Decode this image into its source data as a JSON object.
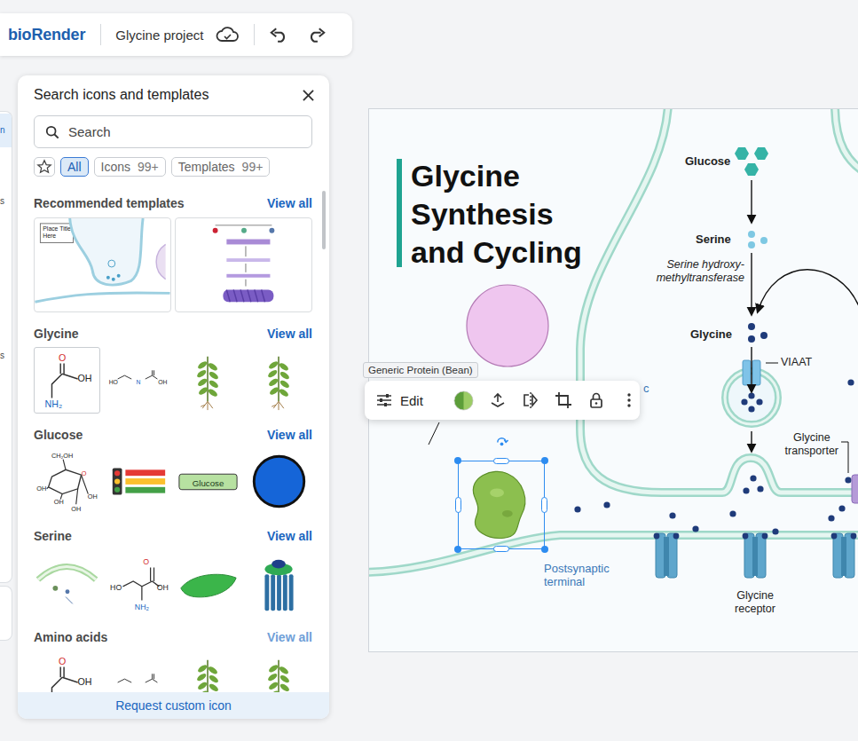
{
  "toolbar": {
    "logo": "bioRender",
    "project": "Glycine project"
  },
  "side_rail": {
    "fragments": [
      {
        "text": "n",
        "selected": true
      },
      {
        "text": "s",
        "selected": false
      },
      {
        "text": "s",
        "selected": false
      }
    ]
  },
  "panel": {
    "title": "Search icons and templates",
    "search": {
      "placeholder": "Search"
    },
    "filters": [
      {
        "label": "All",
        "count": "",
        "selected": true
      },
      {
        "label": "Icons",
        "count": "99+",
        "selected": false
      },
      {
        "label": "Templates",
        "count": "99+",
        "selected": false
      }
    ],
    "templates": {
      "title": "Recommended templates",
      "view_all": "View all",
      "items": [
        {
          "kind": "synapse",
          "labels": [
            "Place Title",
            "Here"
          ]
        },
        {
          "kind": "flowchart",
          "labels": []
        }
      ]
    },
    "sections": [
      {
        "title": "Glycine",
        "view_all": "View all",
        "muted": false,
        "icons": [
          {
            "kind": "structure-glycine",
            "labels": [
              "O",
              "OH",
              "NH₂"
            ],
            "hovered": true
          },
          {
            "kind": "chain",
            "labels": [
              "HO",
              "N",
              "OH"
            ],
            "hovered": false
          },
          {
            "kind": "plant",
            "labels": [],
            "hovered": false
          },
          {
            "kind": "plant",
            "labels": [],
            "hovered": false
          }
        ]
      },
      {
        "title": "Glucose",
        "view_all": "View all",
        "muted": false,
        "icons": [
          {
            "kind": "structure-glucose",
            "labels": [
              "CH₂OH",
              "O",
              "OH",
              "OH",
              "OH",
              "OH"
            ],
            "hovered": false
          },
          {
            "kind": "traffic",
            "labels": [],
            "hovered": false
          },
          {
            "kind": "button",
            "labels": [
              "Glucose"
            ],
            "hovered": false
          },
          {
            "kind": "circle",
            "labels": [],
            "hovered": false
          }
        ]
      },
      {
        "title": "Serine",
        "view_all": "View all",
        "muted": false,
        "icons": [
          {
            "kind": "membrane",
            "labels": [],
            "hovered": false
          },
          {
            "kind": "structure-serine",
            "labels": [
              "O",
              "HO",
              "OH",
              "NH₂"
            ],
            "hovered": false
          },
          {
            "kind": "bean",
            "labels": [],
            "hovered": false
          },
          {
            "kind": "receptor",
            "labels": [],
            "hovered": false
          }
        ]
      },
      {
        "title": "Amino acids",
        "view_all": "View all",
        "muted": true,
        "icons": [
          {
            "kind": "structure-glycine",
            "labels": [
              "O",
              "OH"
            ],
            "hovered": false
          },
          {
            "kind": "chain",
            "labels": [],
            "hovered": false
          },
          {
            "kind": "plant",
            "labels": [],
            "hovered": false
          },
          {
            "kind": "plant",
            "labels": [],
            "hovered": false
          }
        ]
      }
    ],
    "footer": "Request custom icon"
  },
  "canvas": {
    "title_lines": [
      "Glycine",
      "Synthesis",
      "and Cycling"
    ],
    "labels": {
      "glucose": "Glucose",
      "serine": "Serine",
      "enzyme": [
        "Serine hydroxy-",
        "methyltransferase"
      ],
      "glycine": "Glycine",
      "viaat": "VIAAT",
      "transporter": [
        "Glycine",
        "transporter"
      ],
      "receptor": [
        "Glycine",
        "receptor"
      ],
      "postsynaptic": [
        "Postsynaptic",
        "terminal"
      ],
      "presynaptic": "c"
    }
  },
  "selection": {
    "name": "Generic Protein (Bean)",
    "edit": "Edit"
  }
}
